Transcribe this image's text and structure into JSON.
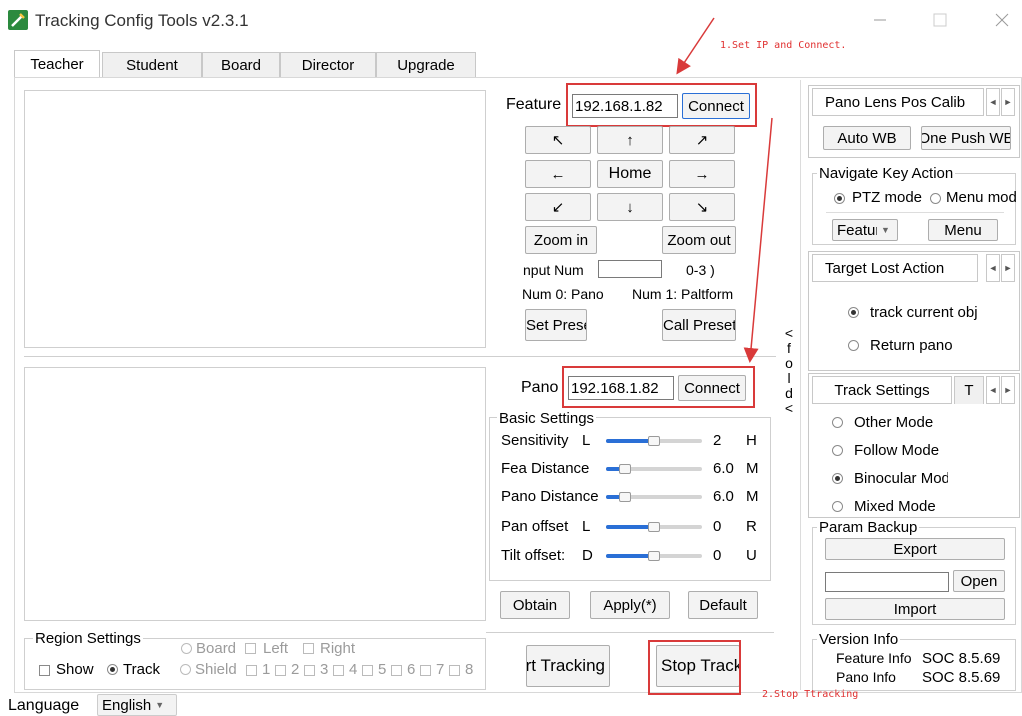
{
  "window": {
    "title": "Tracking Config Tools v2.3.1",
    "minimize_icon": "minimize-icon",
    "maximize_icon": "maximize-icon",
    "close_icon": "close-icon"
  },
  "tabs": [
    {
      "label": "Teacher"
    },
    {
      "label": "Student"
    },
    {
      "label": "Board"
    },
    {
      "label": "Director"
    },
    {
      "label": "Upgrade"
    }
  ],
  "feature": {
    "label": "Feature",
    "ip": "192.168.1.82",
    "connect": "Connect",
    "arrows": {
      "ul": "↖",
      "up": "↑",
      "ur": "↗",
      "left": "←",
      "home": "Home",
      "right": "→",
      "dl": "↙",
      "down": "↓",
      "dr": "↘"
    },
    "zoom_in": "Zoom in",
    "zoom_out": "Zoom out",
    "input_num_label": "nput Num",
    "input_num_value": "",
    "range": "0-3 )",
    "num0": "Num 0: Pano",
    "num1": "Num 1: Paltform",
    "set_preset": "Set Preset",
    "call_preset": "Call Preset"
  },
  "fold": {
    "lt": "<",
    "f": "f",
    "o": "o",
    "l": "l",
    "d": "d",
    "gt": "<"
  },
  "pano": {
    "label": "Pano",
    "ip": "192.168.1.82",
    "connect": "Connect"
  },
  "basic_settings": {
    "title": "Basic Settings",
    "rows": [
      {
        "label": "Sensitivity",
        "left": "L",
        "value": "2",
        "right": "H",
        "fraction": 0.5
      },
      {
        "label": "Fea Distance",
        "left": "",
        "value": "6.0",
        "right": "M",
        "fraction": 0.2
      },
      {
        "label": "Pano Distance",
        "left": "",
        "value": "6.0",
        "right": "M",
        "fraction": 0.2
      },
      {
        "label": "Pan offset",
        "left": "L",
        "value": "0",
        "right": "R",
        "fraction": 0.5
      },
      {
        "label": "Tilt offset:",
        "left": "D",
        "value": "0",
        "right": "U",
        "fraction": 0.5
      }
    ],
    "obtain": "Obtain",
    "apply": "Apply(*)",
    "default": "Default"
  },
  "tracking": {
    "start": "Start Tracking",
    "stop": "Stop Tracking"
  },
  "region": {
    "title": "Region Settings",
    "modes": [
      {
        "label": "Board",
        "selected": false
      },
      {
        "label": "Left",
        "checked": false
      },
      {
        "label": "Right",
        "checked": false
      }
    ],
    "show": "Show",
    "track": "Track",
    "shield": "Shield",
    "numbers": [
      "1",
      "2",
      "3",
      "4",
      "5",
      "6",
      "7",
      "8"
    ]
  },
  "language": {
    "label": "Language",
    "value": "English"
  },
  "right": {
    "lens_tab": "Pano Lens Pos Calib",
    "auto_wb": "Auto WB",
    "one_push": "One Push WB",
    "nav_title": "Navigate Key Action",
    "ptz_mode": "PTZ mode",
    "menu_mode": "Menu mode",
    "feature_select": "Feature",
    "menu_button": "Menu",
    "target_lost_tab": "Target Lost Action",
    "track_current": "track current obj",
    "return_pano": "Return pano",
    "track_settings_tab": "Track Settings",
    "track_settings_tab2": "T",
    "modes": [
      {
        "label": "Other Mode",
        "selected": false
      },
      {
        "label": "Follow Mode",
        "selected": false
      },
      {
        "label": "Binocular Mode",
        "selected": true
      },
      {
        "label": "Mixed Mode",
        "selected": false
      }
    ],
    "param_backup": "Param Backup",
    "export": "Export",
    "open": "Open",
    "import": "Import",
    "version_title": "Version Info",
    "feature_ver_label": "Feature Info",
    "feature_ver": "SOC 8.5.69",
    "pano_ver_label": "Pano Info",
    "pano_ver": "SOC 8.5.69"
  },
  "annotations": {
    "step1": "1.Set IP and Connect.",
    "step2": "2.Stop Ttracking"
  },
  "colors": {
    "accent": "#2a6fd6",
    "annotation": "#d93a3a"
  }
}
